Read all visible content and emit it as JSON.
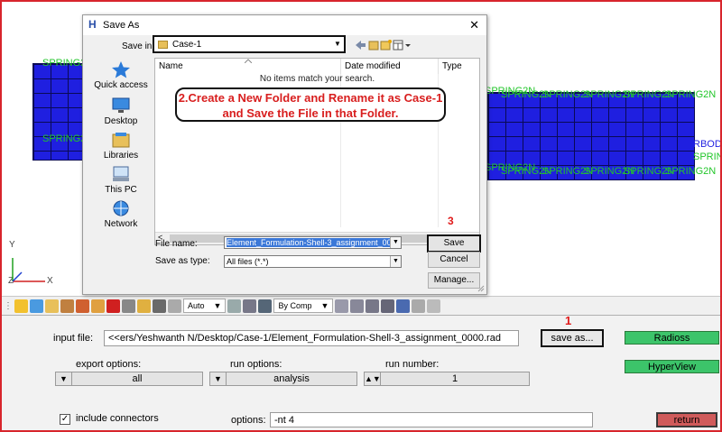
{
  "viewport": {
    "spring_label": "SPRING2",
    "spring_label_n": "SPRING2N",
    "rbody_label": "RBOD",
    "axis_y": "Y",
    "axis_z": "Z",
    "axis_x": "X"
  },
  "dialog": {
    "title": "Save  As",
    "close_glyph": "✕",
    "save_in_label": "Save in:",
    "save_in_value": "Case-1",
    "places": [
      "Quick access",
      "Desktop",
      "Libraries",
      "This PC",
      "Network"
    ],
    "columns": [
      "Name",
      "Date modified",
      "Type"
    ],
    "empty_message": "No items match your search.",
    "callout_text": "2.Create a New Folder and Rename it as Case-1 and Save the File in that Folder.",
    "file_name_label": "File name:",
    "file_name_value": "Element_Formulation-Shell-3_assignment_0000.rad",
    "save_as_type_label": "Save as type:",
    "save_as_type_value": "All files (*.*)",
    "save_button": "Save",
    "cancel_button": "Cancel",
    "manage_button": "Manage...",
    "step_marker": "3"
  },
  "toolbar": {
    "auto_select": "Auto",
    "comp_select": "By Comp"
  },
  "panel": {
    "input_file_label": "input file:",
    "input_file_value": "<<ers/Yeshwanth N/Desktop/Case-1/Element_Formulation-Shell-3_assignment_0000.rad",
    "save_as_button": "save as...",
    "step_marker": "1",
    "radioss_button": "Radioss",
    "hyperview_button": "HyperView",
    "export_options_label": "export options:",
    "export_options_value": "all",
    "run_options_label": "run options:",
    "run_options_value": "analysis",
    "run_number_label": "run number:",
    "run_number_value": "1",
    "include_connectors_label": "include connectors",
    "include_connectors_checked": true,
    "options_label": "options:",
    "options_value": "-nt 4",
    "return_button": "return"
  },
  "colors": {
    "frame": "#d8252c",
    "mesh": "#1f1fe0",
    "spring_text": "#22c62a",
    "green_button": "#3cc46a",
    "return_button": "#d05b5b"
  }
}
